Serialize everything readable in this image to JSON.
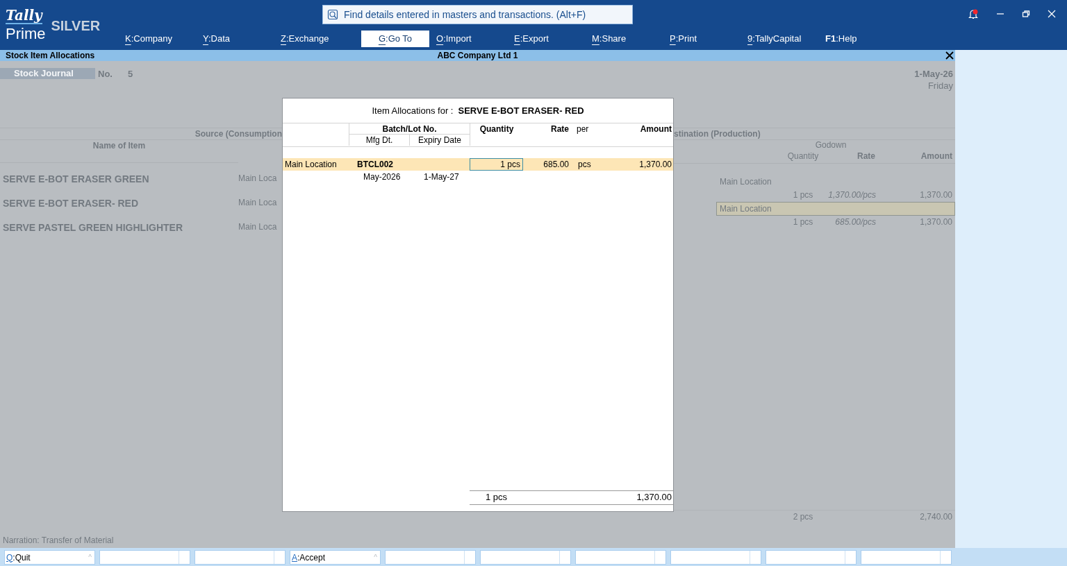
{
  "app": {
    "brand": "Tally",
    "product": "Prime",
    "edition": "SILVER"
  },
  "search": {
    "placeholder": "Find details entered in masters and transactions. (Alt+F)"
  },
  "notification": {
    "unread": true
  },
  "menu": [
    {
      "kind": "letter",
      "key": "K",
      "separator": ":",
      "label": "Company",
      "selected": false
    },
    {
      "kind": "letter",
      "key": "Y",
      "separator": ":",
      "label": "Data",
      "selected": false
    },
    {
      "kind": "letter",
      "key": "Z",
      "separator": ":",
      "label": "Exchange",
      "selected": false
    },
    {
      "kind": "letter",
      "key": "G",
      "separator": ":",
      "label": "Go To",
      "selected": true
    },
    {
      "kind": "letter",
      "key": "O",
      "separator": ":",
      "label": "Import",
      "selected": false
    },
    {
      "kind": "letter",
      "key": "E",
      "separator": ":",
      "label": "Export",
      "selected": false
    },
    {
      "kind": "letter",
      "key": "M",
      "separator": ":",
      "label": "Share",
      "selected": false
    },
    {
      "kind": "letter",
      "key": "P",
      "separator": ":",
      "label": "Print",
      "selected": false
    },
    {
      "kind": "letter",
      "key": "9",
      "separator": ":",
      "label": "TallyCapital",
      "selected": false
    },
    {
      "kind": "function",
      "key": "F1",
      "separator": ":",
      "label": "Help",
      "selected": false
    }
  ],
  "screen": {
    "title": "Stock Item Allocations",
    "company": "ABC Company Ltd 1"
  },
  "voucher": {
    "type": "Stock Journal",
    "number_label": "No.",
    "number": "5",
    "date": "1-May-26",
    "day": "Friday",
    "source": {
      "heading": "Source (Consumption",
      "name_heading": "Name of Item",
      "items": [
        {
          "name": "SERVE E-BOT ERASER GREEN",
          "godown": "Main Loca"
        },
        {
          "name": "SERVE E-BOT ERASER- RED",
          "godown": "Main Loca"
        },
        {
          "name": "SERVE PASTEL GREEN HIGHLIGHTER",
          "godown": "Main Loca"
        }
      ]
    },
    "destination": {
      "heading": "stination (Production)",
      "godown_heading": "Godown",
      "quantity_heading": "Quantity",
      "rate_heading": "Rate",
      "amount_heading": "Amount",
      "entries": [
        {
          "godown": "Main Location",
          "quantity": "1 pcs",
          "rate": "1,370.00/pcs",
          "amount": "1,370.00",
          "selected": false
        },
        {
          "godown": "Main Location",
          "quantity": "1 pcs",
          "rate": "685.00/pcs",
          "amount": "1,370.00",
          "selected": true
        }
      ],
      "total_quantity": "2 pcs",
      "total_amount": "2,740.00"
    },
    "narration_label": "Narration:",
    "narration": "Transfer of Material"
  },
  "allocation": {
    "title_label": "Item Allocations for :",
    "item": "SERVE E-BOT ERASER- RED",
    "columns": {
      "batch": "Batch/Lot No.",
      "mfg": "Mfg Dt.",
      "expiry": "Expiry Date",
      "quantity": "Quantity",
      "rate": "Rate",
      "per": "per",
      "amount": "Amount"
    },
    "rows": [
      {
        "godown": "Main Location",
        "batch": "BTCL002",
        "mfg": "May-2026",
        "expiry": "1-May-27",
        "quantity": "1 pcs",
        "rate": "685.00",
        "per": "pcs",
        "amount": "1,370.00",
        "selected": true
      }
    ],
    "total_quantity": "1 pcs",
    "total_amount": "1,370.00"
  },
  "buttons": [
    {
      "kind": "action",
      "key": "Q",
      "separator": ":",
      "label": "Quit",
      "hint": "^"
    },
    {
      "kind": "empty"
    },
    {
      "kind": "empty"
    },
    {
      "kind": "action",
      "key": "A",
      "separator": ":",
      "label": "Accept",
      "hint": "^"
    },
    {
      "kind": "empty"
    },
    {
      "kind": "empty"
    },
    {
      "kind": "empty"
    },
    {
      "kind": "empty"
    },
    {
      "kind": "empty"
    },
    {
      "kind": "empty"
    }
  ]
}
